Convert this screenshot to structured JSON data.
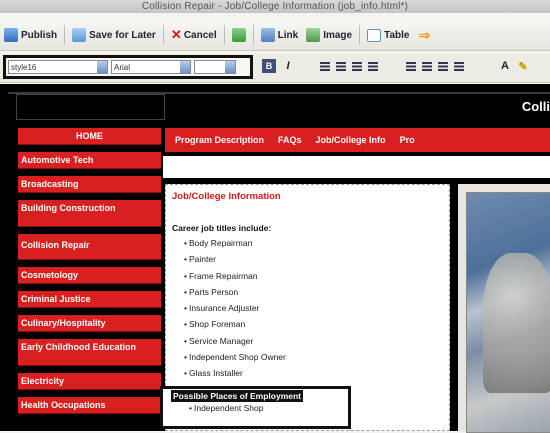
{
  "window": {
    "title": "Collision Repair - Job/College Information (job_info.html*)"
  },
  "toolbar": {
    "publish": "Publish",
    "save_later": "Save for Later",
    "cancel": "Cancel",
    "link": "Link",
    "image": "Image",
    "table": "Table"
  },
  "format": {
    "style": "style16",
    "font": "Arial",
    "size": ""
  },
  "site": {
    "title": "Colli"
  },
  "sidebar": {
    "items": [
      "HOME",
      "Automotive Tech",
      "Broadcasting",
      "Building Construction",
      "Collision Repair",
      "Cosmetology",
      "Criminal Justice",
      "Culinary/Hospitality",
      "Early Childhood Education",
      "Electricity",
      "Health Occupations"
    ]
  },
  "topnav": {
    "items": [
      "Program Description",
      "FAQs",
      "Job/College Info",
      "Pro"
    ]
  },
  "content": {
    "title": "Job/College Information",
    "intro": "Career job titles include:",
    "jobs": [
      "Body Repairman",
      "Painter",
      "Frame Repairman",
      "Parts Person",
      "Insurance Adjuster",
      "Shop Foreman",
      "Service Manager",
      "Independent Shop Owner",
      "Glass Installer"
    ],
    "places_header": "Possible Places of Employment",
    "places": [
      "Independent Shop"
    ]
  },
  "colors": {
    "accent_red": "#d92020",
    "highlight_box": "#111111"
  }
}
